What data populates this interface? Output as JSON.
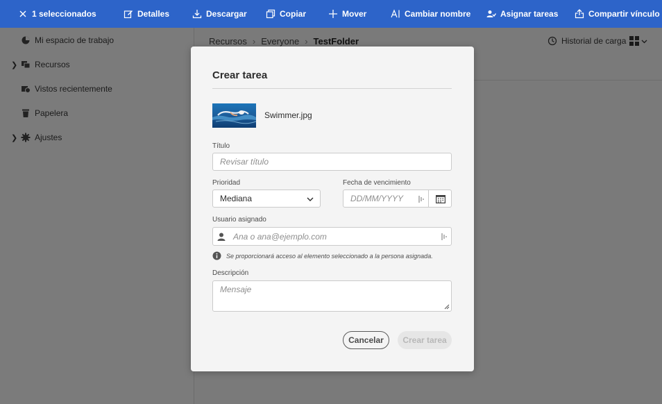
{
  "actionbar": {
    "selected_label": "1 seleccionados",
    "details": "Detalles",
    "download": "Descargar",
    "copy": "Copiar",
    "move": "Mover",
    "rename": "Cambiar nombre",
    "assign": "Asignar tareas",
    "share": "Compartir vínculo"
  },
  "sidebar": {
    "items": [
      {
        "label": "Mi espacio de trabajo",
        "icon": "workspace-icon",
        "expandable": false
      },
      {
        "label": "Recursos",
        "icon": "assets-icon",
        "expandable": true
      },
      {
        "label": "Vistos recientemente",
        "icon": "recent-icon",
        "expandable": false
      },
      {
        "label": "Papelera",
        "icon": "trash-icon",
        "expandable": false
      },
      {
        "label": "Ajustes",
        "icon": "gear-icon",
        "expandable": true
      }
    ]
  },
  "breadcrumb": {
    "items": [
      "Recursos",
      "Everyone"
    ],
    "current": "TestFolder",
    "separator": "›"
  },
  "header": {
    "upload_history": "Historial de carga"
  },
  "modal": {
    "title": "Crear tarea",
    "file_name": "Swimmer.jpg",
    "title_label": "Título",
    "title_placeholder": "Revisar título",
    "priority_label": "Prioridad",
    "priority_value": "Mediana",
    "due_label": "Fecha de vencimiento",
    "due_placeholder": "DD/MM/YYYY",
    "assignee_label": "Usuario asignado",
    "assignee_placeholder": "Ana o ana@ejemplo.com",
    "info_text": "Se proporcionará acceso al elemento seleccionado a la persona asignada.",
    "description_label": "Descripción",
    "description_placeholder": "Mensaje",
    "cancel": "Cancelar",
    "create": "Crear tarea"
  },
  "colors": {
    "actionbar": "#2d64c9",
    "overlay_page": "#7a7a7a",
    "modal_bg": "#f4f4f4"
  }
}
